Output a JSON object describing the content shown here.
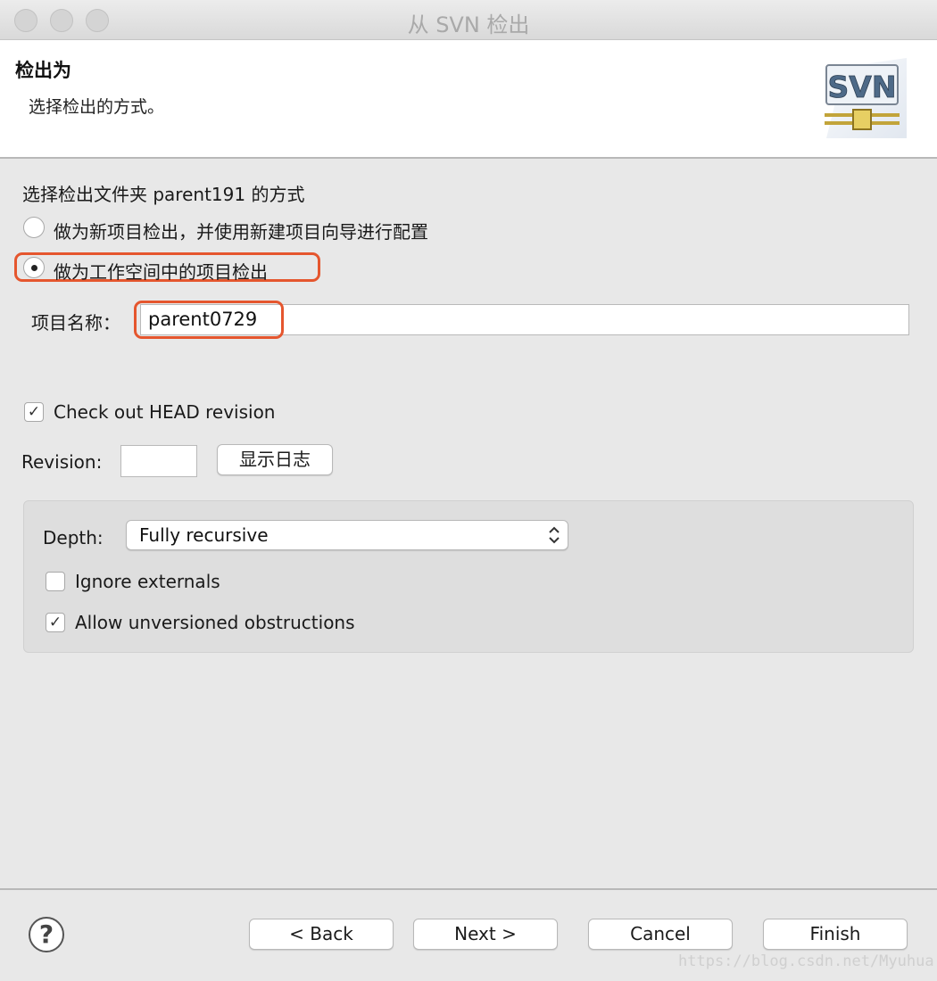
{
  "window": {
    "title": "从 SVN 检出"
  },
  "header": {
    "title": "检出为",
    "description": "选择检出的方式。",
    "logo_text": "SVN"
  },
  "checkout": {
    "prompt": "选择检出文件夹 parent191 的方式",
    "options": [
      {
        "label": "做为新项目检出，并使用新建项目向导进行配置",
        "selected": false
      },
      {
        "label": "做为工作空间中的项目检出",
        "selected": true
      }
    ],
    "project_name_label": "项目名称：",
    "project_name_value": "parent0729"
  },
  "revision": {
    "head_checkbox_label": "Check out HEAD revision",
    "head_checked": true,
    "revision_label": "Revision:",
    "revision_value": "",
    "show_log_button": "显示日志"
  },
  "depth": {
    "label": "Depth:",
    "selected": "Fully recursive",
    "ignore_externals_label": "Ignore externals",
    "ignore_externals_checked": false,
    "allow_unversioned_label": "Allow unversioned obstructions",
    "allow_unversioned_checked": true
  },
  "footer": {
    "help_icon": "?",
    "back_button": "< Back",
    "next_button": "Next >",
    "cancel_button": "Cancel",
    "finish_button": "Finish"
  },
  "watermark": "https://blog.csdn.net/Myuhua",
  "colors": {
    "highlight_border": "#e5562e",
    "background": "#e8e8e8"
  },
  "check_mark": "✓"
}
